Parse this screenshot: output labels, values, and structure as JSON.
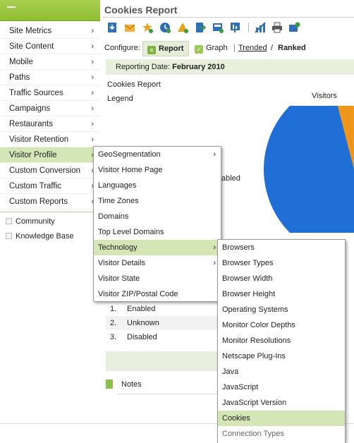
{
  "sidebar": {
    "items": [
      {
        "label": "Site Metrics",
        "arrow": true
      },
      {
        "label": "Site Content",
        "arrow": true
      },
      {
        "label": "Mobile",
        "arrow": true
      },
      {
        "label": "Paths",
        "arrow": true
      },
      {
        "label": "Traffic Sources",
        "arrow": true
      },
      {
        "label": "Campaigns",
        "arrow": true
      },
      {
        "label": "Restaurants",
        "arrow": true
      },
      {
        "label": "Visitor Retention",
        "arrow": true
      },
      {
        "label": "Visitor Profile",
        "arrow": true
      },
      {
        "label": "Custom Conversion",
        "arrow": true
      },
      {
        "label": "Custom Traffic",
        "arrow": true
      },
      {
        "label": "Custom Reports",
        "arrow": true
      }
    ],
    "links": [
      "Community",
      "Knowledge Base"
    ],
    "active_item": "Visitor Profile",
    "accent_color": "#8fbd33"
  },
  "header": {
    "title": "Cookies Report"
  },
  "toolbar": {
    "icons": [
      "download-icon",
      "email-icon",
      "bookmark-star-icon",
      "schedule-icon",
      "alert-icon",
      "export-icon",
      "dashboard-add-icon",
      "presentation-icon",
      "chart-icon",
      "print-icon",
      "share-icon"
    ]
  },
  "configure": {
    "label": "Configure:",
    "tab_report": "Report",
    "tab_graph": "Graph",
    "separator_1": "|",
    "link_trended": "Trended",
    "separator_2": "/",
    "link_ranked": "Ranked"
  },
  "report": {
    "date_prefix": "Reporting Date:",
    "date_value": "February 2010",
    "section_title": "Cookies Report",
    "legend_label": "Legend",
    "pie_label": "Visitors",
    "partial_text": "abled",
    "rows": [
      {
        "rank": "1.",
        "name": "Enabled"
      },
      {
        "rank": "2.",
        "name": "Unknown"
      },
      {
        "rank": "3.",
        "name": "Disabled"
      }
    ],
    "notes_label": "Notes"
  },
  "menu_visitor_profile": {
    "items": [
      {
        "label": "GeoSegmentation",
        "arrow": true
      },
      {
        "label": "Visitor Home Page",
        "arrow": false
      },
      {
        "label": "Languages",
        "arrow": false
      },
      {
        "label": "Time Zones",
        "arrow": false
      },
      {
        "label": "Domains",
        "arrow": false
      },
      {
        "label": "Top Level Domains",
        "arrow": false
      },
      {
        "label": "Technology",
        "arrow": true
      },
      {
        "label": "Visitor Details",
        "arrow": true
      },
      {
        "label": "Visitor State",
        "arrow": false
      },
      {
        "label": "Visitor ZIP/Postal Code",
        "arrow": false
      }
    ],
    "active_item": "Technology"
  },
  "menu_technology": {
    "items": [
      "Browsers",
      "Browser Types",
      "Browser Width",
      "Browser Height",
      "Operating Systems",
      "Monitor Color Depths",
      "Monitor Resolutions",
      "Netscape Plug-Ins",
      "Java",
      "JavaScript",
      "JavaScript Version",
      "Cookies",
      "Connection Types"
    ],
    "active_item": "Cookies"
  },
  "colors": {
    "pie_main": "#1f6fd6",
    "pie_slice": "#f0961b",
    "menu_highlight": "#d4e5b6"
  }
}
